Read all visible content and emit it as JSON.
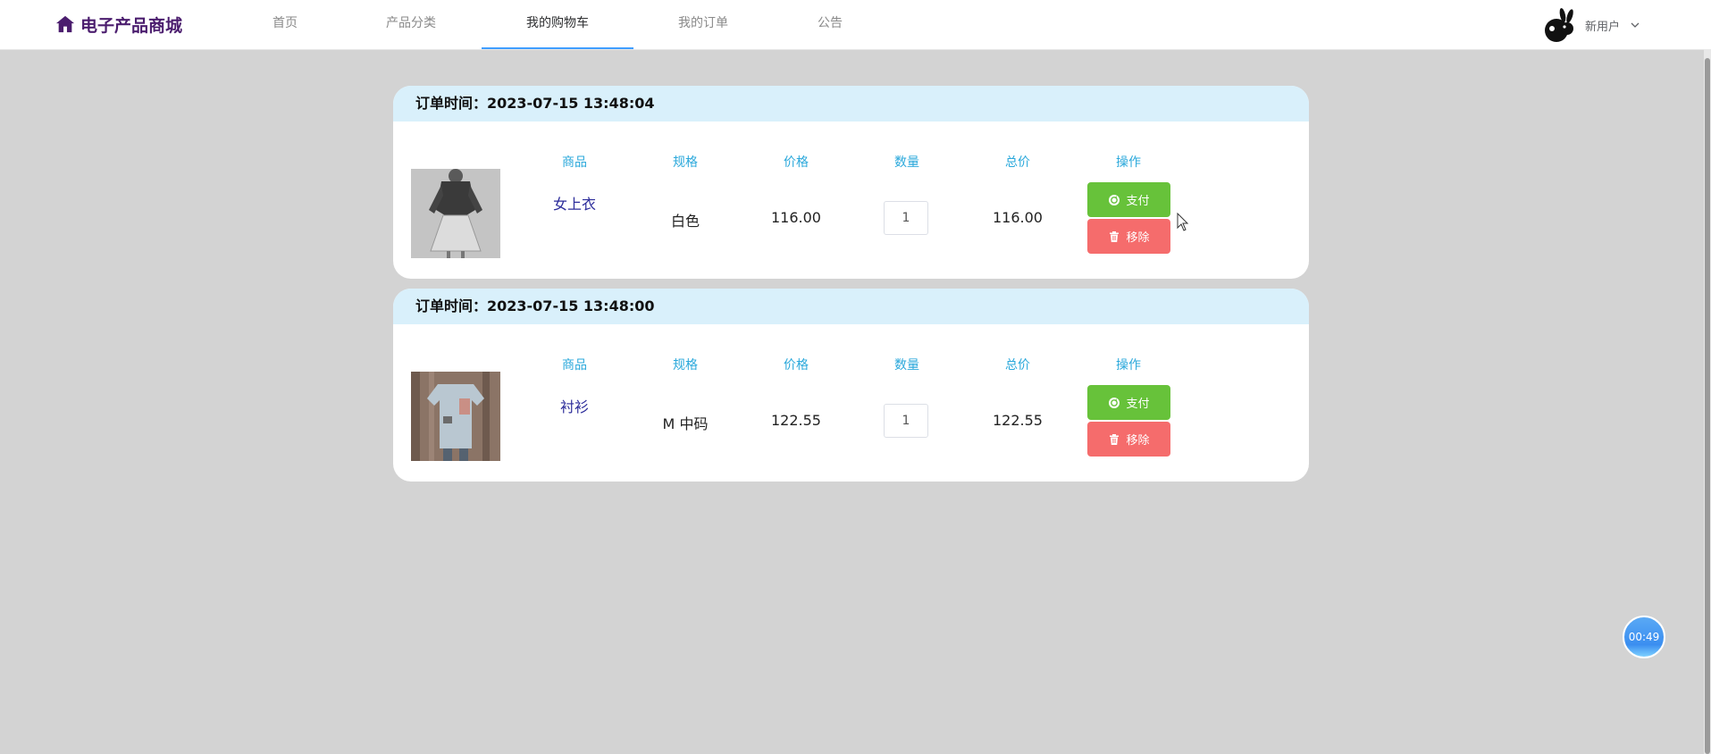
{
  "header": {
    "brand": "电子产品商城",
    "nav": [
      {
        "label": "首页",
        "active": false
      },
      {
        "label": "产品分类",
        "active": false
      },
      {
        "label": "我的购物车",
        "active": true
      },
      {
        "label": "我的订单",
        "active": false
      },
      {
        "label": "公告",
        "active": false
      }
    ],
    "user_name": "新用户"
  },
  "columns": {
    "product": "商品",
    "spec": "规格",
    "price": "价格",
    "quantity": "数量",
    "total": "总价",
    "actions": "操作"
  },
  "buttons": {
    "pay": "支付",
    "remove": "移除"
  },
  "orders": [
    {
      "time_label": "订单时间：2023-07-15 13:48:04",
      "product_name": "女上衣",
      "spec": "白色",
      "price": "116.00",
      "quantity": "1",
      "total": "116.00"
    },
    {
      "time_label": "订单时间：2023-07-15 13:48:00",
      "product_name": "衬衫",
      "spec": "M 中码",
      "price": "122.55",
      "quantity": "1",
      "total": "122.55"
    }
  ],
  "timer": "00:49",
  "colors": {
    "brand": "#4b1d6e",
    "nav_active_underline": "#409eff",
    "card_header_bg": "#d9f0fb",
    "column_header": "#2aa8db",
    "product_link": "#2b2b9a",
    "pay_button": "#67c23a",
    "remove_button": "#f56c6c",
    "page_bg": "#d3d3d3"
  }
}
